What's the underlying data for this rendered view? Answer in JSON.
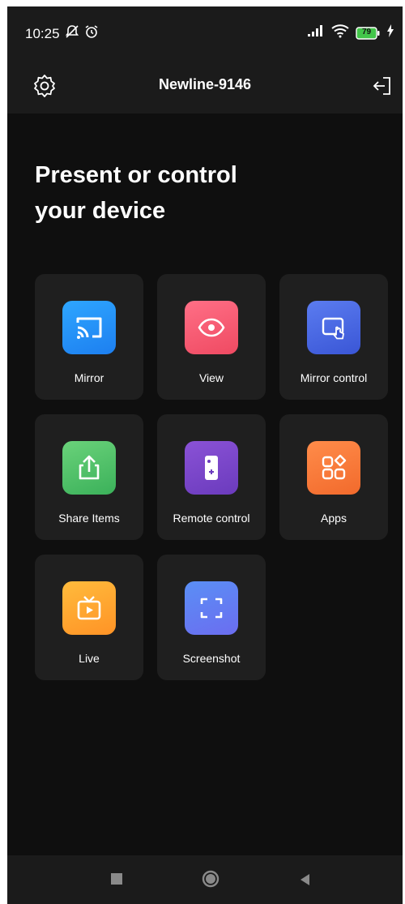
{
  "status": {
    "time": "10:25",
    "battery_level": "79",
    "left_icons": [
      "notifications-off-icon",
      "alarm-icon"
    ],
    "right_icons": [
      "signal-icon",
      "wifi-icon",
      "battery-icon",
      "charging-icon"
    ]
  },
  "appbar": {
    "title": "Newline-9146",
    "settings_icon": "gear-icon",
    "exit_icon": "exit-icon"
  },
  "headline": {
    "line1": "Present or control",
    "line2": "your device"
  },
  "features": [
    {
      "label": "Mirror",
      "icon": "cast-icon",
      "colors": [
        "#2ea6ff",
        "#1d7ff0"
      ]
    },
    {
      "label": "View",
      "icon": "eye-icon",
      "colors": [
        "#ff6f86",
        "#ef4a62"
      ]
    },
    {
      "label": "Mirror control",
      "icon": "screen-touch-icon",
      "colors": [
        "#5b7cf0",
        "#3a56d6"
      ]
    },
    {
      "label": "Share Items",
      "icon": "share-upload-icon",
      "colors": [
        "#6ad27a",
        "#3bb15a"
      ]
    },
    {
      "label": "Remote control",
      "icon": "remote-icon",
      "colors": [
        "#8a52d6",
        "#6b3bbd"
      ]
    },
    {
      "label": "Apps",
      "icon": "apps-icon",
      "colors": [
        "#ff8c4a",
        "#f26a2c"
      ]
    },
    {
      "label": "Live",
      "icon": "tv-play-icon",
      "colors": [
        "#ffbb3c",
        "#ff9326"
      ]
    },
    {
      "label": "Screenshot",
      "icon": "screenshot-frame-icon",
      "colors": [
        "#5a8ff5",
        "#6b6df0"
      ]
    }
  ],
  "navbar": {
    "recent_icon": "square-icon",
    "home_icon": "circle-icon",
    "back_icon": "triangle-back-icon"
  }
}
